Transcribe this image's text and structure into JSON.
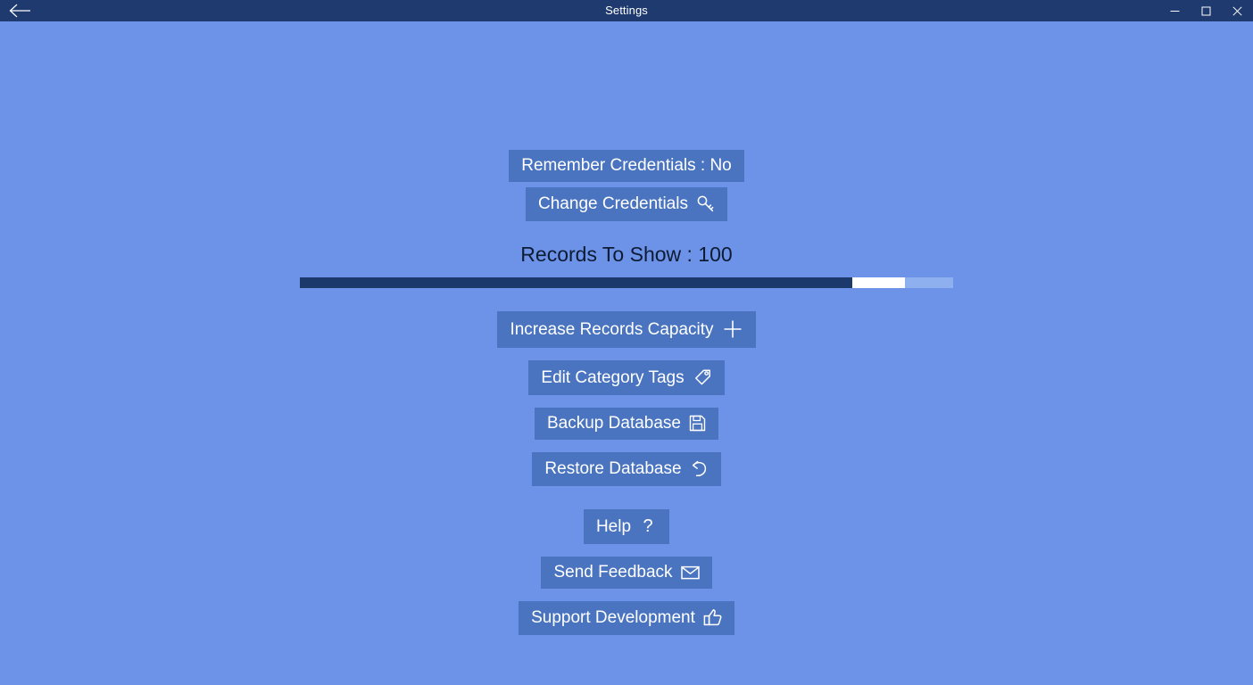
{
  "window": {
    "title": "Settings",
    "back_icon": "back-arrow-icon",
    "minimize_label": "–",
    "maximize_label": "☐",
    "close_label": "✕"
  },
  "settings": {
    "remember_credentials": {
      "label": "Remember Credentials : No",
      "value": "No"
    },
    "change_credentials": {
      "label": "Change Credentials",
      "icon": "key-icon"
    },
    "records_to_show": {
      "label": "Records To Show : 100",
      "value": 100,
      "min": 0,
      "max": 100,
      "percent": 92
    },
    "increase_records_capacity": {
      "label": "Increase Records Capacity",
      "icon": "plus-icon"
    },
    "edit_category_tags": {
      "label": "Edit Category Tags",
      "icon": "tag-icon"
    },
    "backup_database": {
      "label": "Backup Database",
      "icon": "save-floppy-icon"
    },
    "restore_database": {
      "label": "Restore Database",
      "icon": "undo-arrow-icon"
    },
    "help": {
      "label": "Help",
      "icon": "question-mark-icon"
    },
    "send_feedback": {
      "label": "Send Feedback",
      "icon": "envelope-icon"
    },
    "support_development": {
      "label": "Support Development",
      "icon": "thumbs-up-icon"
    }
  },
  "colors": {
    "titlebar": "#1e3a6e",
    "page_background": "#6d93e8",
    "button_background": "#4a74c0",
    "slider_fill": "#1b3a6b",
    "slider_thumb": "#ffffff",
    "button_text": "#ffffff",
    "label_text": "#0d1b33"
  }
}
